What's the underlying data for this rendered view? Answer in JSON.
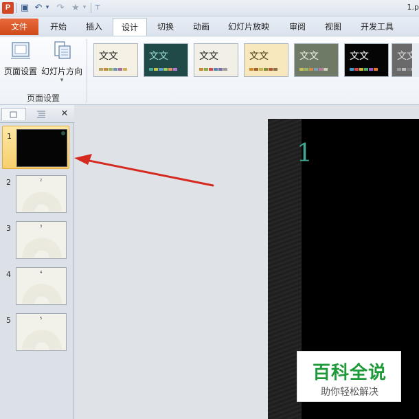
{
  "window": {
    "title": "1.p"
  },
  "quick_access": {
    "app_icon": "P",
    "icons": [
      "save-icon",
      "undo-icon",
      "redo-icon",
      "star-icon",
      "customize-icon"
    ],
    "glyphs": {
      "save": "▣",
      "undo": "↶",
      "undo_drop": "▾",
      "redo": "↷",
      "star": "★",
      "star_drop": "▾",
      "customize": "⊤"
    }
  },
  "tabs": [
    {
      "label": "文件"
    },
    {
      "label": "开始"
    },
    {
      "label": "插入"
    },
    {
      "label": "设计"
    },
    {
      "label": "切换"
    },
    {
      "label": "动画"
    },
    {
      "label": "幻灯片放映"
    },
    {
      "label": "审阅"
    },
    {
      "label": "视图"
    },
    {
      "label": "开发工具"
    }
  ],
  "ribbon": {
    "page_setup_label": "页面设置",
    "orientation_label": "幻灯片方向",
    "orientation_dropdown": "▾",
    "group_label": "页面设置",
    "themes": [
      {
        "text": "文文",
        "bg": "#f4f1e4",
        "fg": "#222222",
        "colors": [
          "#b5a26a",
          "#c98a42",
          "#9ab35c",
          "#6f94b8",
          "#a76fa0",
          "#d1b15a"
        ]
      },
      {
        "text": "文文",
        "bg": "#1f4a48",
        "fg": "#9fe0d0",
        "colors": [
          "#4aa89b",
          "#c8c34a",
          "#5ea0c8",
          "#9ccf6a",
          "#e3905a",
          "#b07ad0"
        ]
      },
      {
        "text": "文文",
        "bg": "#f1efe6",
        "fg": "#222222",
        "colors": [
          "#c58b3c",
          "#8fa84e",
          "#c94f4f",
          "#5d86b4",
          "#7d6ba8",
          "#9d9d9d"
        ]
      },
      {
        "text": "文文",
        "bg": "#f6e7bd",
        "fg": "#4a3a12",
        "colors": [
          "#d08a2a",
          "#a0642a",
          "#c4b34a",
          "#7f8f3a",
          "#b3562a",
          "#8d6f4a"
        ]
      },
      {
        "text": "文文",
        "bg": "#6f7a66",
        "fg": "#f1f1ea",
        "colors": [
          "#c9c25a",
          "#9ab76a",
          "#d38c4a",
          "#7d9fb5",
          "#b87a9c",
          "#d0d0c0"
        ]
      },
      {
        "text": "文文",
        "bg": "#050505",
        "fg": "#ffffff",
        "colors": [
          "#3fa0d0",
          "#d04a4a",
          "#d0b53a",
          "#4ab06a",
          "#a05ad0",
          "#e07a2a"
        ]
      },
      {
        "text": "文文",
        "bg": "#6a6a6a",
        "fg": "#dddddd",
        "colors": [
          "#9a9a9a",
          "#bbbbbb",
          "#7c7c7c",
          "#d0d0d0",
          "#5e5e5e",
          "#aaaaaa"
        ]
      }
    ]
  },
  "thumbnail_pane": {
    "tab_slides_icon": "slides-tab-icon",
    "tab_outline_icon": "outline-tab-icon",
    "close_glyph": "✕",
    "slides": [
      {
        "number": "1",
        "selected": true
      },
      {
        "number": "2",
        "selected": false,
        "mini_text": "2"
      },
      {
        "number": "3",
        "selected": false,
        "mini_text": "3"
      },
      {
        "number": "4",
        "selected": false,
        "mini_text": "4"
      },
      {
        "number": "5",
        "selected": false,
        "mini_text": "5"
      }
    ]
  },
  "slide": {
    "title_number": "1",
    "accent_color": "#3fa595"
  },
  "watermark": {
    "title": "百科全说",
    "subtitle": "助你轻松解决",
    "color": "#1f9a3a"
  },
  "annotation": {
    "arrow_color": "#d42a20"
  }
}
